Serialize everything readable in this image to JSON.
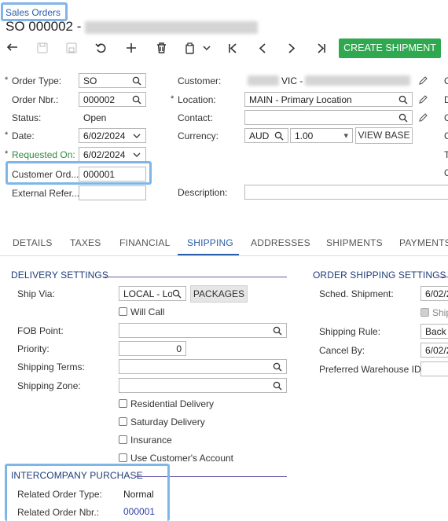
{
  "breadcrumb": "Sales Orders",
  "title": "SO 000002 -",
  "toolbar": {
    "create_shipment": "CREATE SHIPMENT"
  },
  "form": {
    "order_type": {
      "label": "Order Type:",
      "value": "SO"
    },
    "order_nbr": {
      "label": "Order Nbr.:",
      "value": "000002"
    },
    "status": {
      "label": "Status:",
      "value": "Open"
    },
    "date": {
      "label": "Date:",
      "value": "6/02/2024"
    },
    "requested_on": {
      "label": "Requested On:",
      "value": "6/02/2024"
    },
    "customer_order": {
      "label": "Customer Ord...",
      "value": "000001"
    },
    "external_ref": {
      "label": "External Refer..."
    },
    "customer": {
      "label": "Customer:",
      "value": "VIC -"
    },
    "location": {
      "label": "Location:",
      "value": "MAIN - Primary Location"
    },
    "contact": {
      "label": "Contact:"
    },
    "currency": {
      "label": "Currency:",
      "code": "AUD",
      "rate": "1.00",
      "view_base": "VIEW BASE"
    },
    "description": {
      "label": "Description:"
    }
  },
  "tabs": [
    "DETAILS",
    "TAXES",
    "FINANCIAL",
    "SHIPPING",
    "ADDRESSES",
    "SHIPMENTS",
    "PAYMENTS"
  ],
  "active_tab": "SHIPPING",
  "delivery": {
    "title": "DELIVERY SETTINGS",
    "ship_via": {
      "label": "Ship Via:",
      "value": "LOCAL - Lo",
      "packages": "PACKAGES"
    },
    "will_call": "Will Call",
    "fob_point": {
      "label": "FOB Point:"
    },
    "priority": {
      "label": "Priority:",
      "value": "0"
    },
    "shipping_terms": {
      "label": "Shipping Terms:"
    },
    "shipping_zone": {
      "label": "Shipping Zone:"
    },
    "residential": "Residential Delivery",
    "saturday": "Saturday Delivery",
    "insurance": "Insurance",
    "use_customer_account": "Use Customer's Account"
  },
  "order_shipping": {
    "title": "ORDER SHIPPING SETTINGS",
    "sched_shipment": {
      "label": "Sched. Shipment:",
      "value": "6/02/2"
    },
    "ship_partial": "Ship",
    "shipping_rule": {
      "label": "Shipping Rule:",
      "value": "Back"
    },
    "cancel_by": {
      "label": "Cancel By:",
      "value": "6/02/2"
    },
    "preferred_warehouse": {
      "label": "Preferred Warehouse ID:"
    }
  },
  "intercompany": {
    "title": "INTERCOMPANY PURCHASE",
    "related_order_type": {
      "label": "Related Order Type:",
      "value": "Normal"
    },
    "related_order_nbr": {
      "label": "Related Order Nbr.:",
      "value": "000001"
    }
  },
  "right_edge_labels": [
    "O",
    "D",
    "C",
    "C",
    "T",
    "O"
  ],
  "colors": {
    "accent_green": "#2fa84f",
    "link_blue": "#2a5da8",
    "highlight": "#7fb6e8",
    "section_line": "#6a5aa8"
  }
}
